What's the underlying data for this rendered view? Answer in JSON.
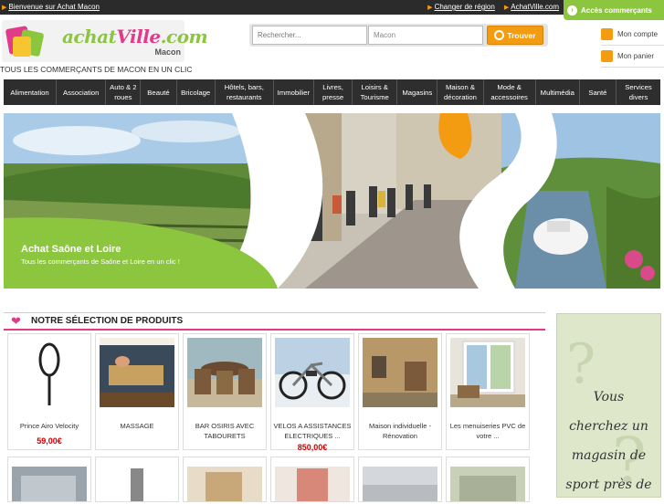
{
  "topbar": {
    "welcome": "Bienvenue sur Achat Macon",
    "change_region": "Changer de région",
    "achatville_link": "AchatVille.com",
    "merchants_access": "Accès commerçants"
  },
  "header": {
    "logo": {
      "part1": "achat",
      "part2": "Ville",
      "part3": ".com",
      "city": "Macon"
    },
    "tagline": "TOUS LES COMMERÇANTS DE MACON EN UN CLIC",
    "search": {
      "query_placeholder": "Rechercher...",
      "location_value": "Macon",
      "button": "Trouver"
    },
    "account": {
      "my_account": "Mon compte",
      "my_cart": "Mon panier"
    }
  },
  "nav": {
    "items": [
      "Alimentation",
      "Association",
      "Auto & 2 roues",
      "Beauté",
      "Bricolage",
      "Hôtels, bars, restaurants",
      "Immobilier",
      "Livres, presse",
      "Loisirs & Tourisme",
      "Magasins",
      "Maison & décoration",
      "Mode & accessoires",
      "Multimédia",
      "Santé",
      "Services divers"
    ]
  },
  "banner": {
    "title": "Achat Saône et Loire",
    "subtitle": "Tous les commerçants de Saône et Loire en un clic !"
  },
  "products": {
    "heading": "NOTRE SÉLECTION DE PRODUITS",
    "items": [
      {
        "name": "Prince Airo Velocity",
        "price": "59,00€"
      },
      {
        "name": "MASSAGE",
        "price": ""
      },
      {
        "name": "BAR OSIRIS AVEC TABOURETS",
        "price": ""
      },
      {
        "name": "VELOS A ASSISTANCES ELECTRIQUES ...",
        "price": "850,00€"
      },
      {
        "name": "Maison individuelle - Rénovation",
        "price": ""
      },
      {
        "name": "Les menuiseries PVC de votre ...",
        "price": ""
      }
    ]
  },
  "ad": {
    "line1": "Vous",
    "line2": "cherchez un",
    "line3": "magasin de",
    "line4": "sport près de"
  },
  "colors": {
    "green": "#8cc63f",
    "pink": "#e23a8a",
    "orange": "#f39c12",
    "nav_bg": "#2e2e2e"
  }
}
